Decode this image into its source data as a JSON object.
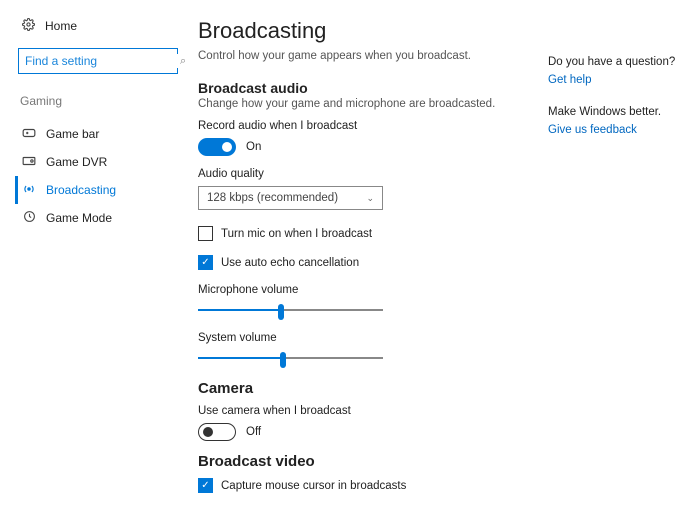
{
  "sidebar": {
    "home": "Home",
    "search_placeholder": "Find a setting",
    "category": "Gaming",
    "items": [
      {
        "label": "Game bar"
      },
      {
        "label": "Game DVR"
      },
      {
        "label": "Broadcasting"
      },
      {
        "label": "Game Mode"
      }
    ]
  },
  "main": {
    "title": "Broadcasting",
    "subtitle": "Control how your game appears when you broadcast.",
    "audio_heading": "Broadcast audio",
    "audio_desc": "Change how your game and microphone are broadcasted.",
    "record_audio_label": "Record audio when I broadcast",
    "record_audio_state": "On",
    "quality_label": "Audio quality",
    "quality_value": "128 kbps (recommended)",
    "turn_mic_label": "Turn mic on when I broadcast",
    "echo_label": "Use auto echo cancellation",
    "mic_vol_label": "Microphone volume",
    "mic_vol_percent": 45,
    "sys_vol_label": "System volume",
    "sys_vol_percent": 46,
    "camera_heading": "Camera",
    "camera_label": "Use camera when I broadcast",
    "camera_state": "Off",
    "video_heading": "Broadcast video",
    "capture_cursor_label": "Capture mouse cursor in broadcasts"
  },
  "right": {
    "question": "Do you have a question?",
    "help_link": "Get help",
    "feedback_intro": "Make Windows better.",
    "feedback_link": "Give us feedback"
  }
}
